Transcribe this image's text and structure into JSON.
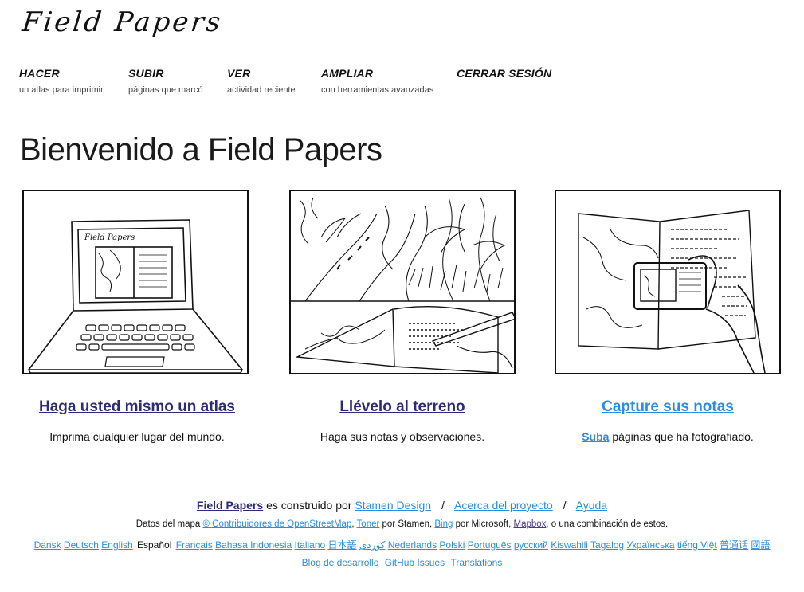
{
  "logo": "Field Papers",
  "nav": [
    {
      "title": "HACER",
      "sub": "un atlas para imprimir"
    },
    {
      "title": "SUBIR",
      "sub": "páginas que marcó"
    },
    {
      "title": "VER",
      "sub": "actividad reciente"
    },
    {
      "title": "AMPLIAR",
      "sub": "con herramientas avanzadas"
    },
    {
      "title": "CERRAR SESIÓN",
      "sub": ""
    }
  ],
  "heading": "Bienvenido a Field Papers",
  "illustration_logo": "Field Papers",
  "columns": [
    {
      "title": "Haga usted mismo un atlas",
      "desc": "Imprima cualquier lugar del mundo.",
      "link_color": "#2b2b7a"
    },
    {
      "title": "Llévelo al terreno",
      "desc": "Haga sus notas y observaciones.",
      "link_color": "#2b2b7a"
    },
    {
      "title": "Capture sus notas",
      "desc_link": "Suba",
      "desc": "páginas que ha fotografiado.",
      "link_color": "#2c8ce0"
    }
  ],
  "footer": {
    "brand": "Field Papers",
    "built_by": "es construido por",
    "stamen": "Stamen Design",
    "about": "Acerca del proyecto",
    "help": "Ayuda",
    "separator": "/",
    "map_data_prefix": "Datos del mapa",
    "osm": "© Contribuidores de OpenStreetMap",
    "comma": ",",
    "toner": "Toner",
    "by_stamen": "por Stamen,",
    "bing": "Bing",
    "by_microsoft": "por Microsoft,",
    "mapbox": "Mapbox",
    "combination": ", o una combinación de estos.",
    "blog": "Blog de desarrollo",
    "github": "GitHub Issues",
    "translations": "Translations"
  },
  "languages": [
    "Dansk",
    "Deutsch",
    "English",
    "Español",
    "Français",
    "Bahasa Indonesia",
    "Italiano",
    "日本語",
    "کوردی",
    "Nederlands",
    "Polski",
    "Português",
    "русский",
    "Kiswahili",
    "Tagalog",
    "Українська",
    "tiếng Việt",
    "普通话",
    "國語"
  ],
  "current_language": "Español",
  "colors": {
    "dark_link": "#2b2b7a",
    "light_link": "#2c8ce0"
  }
}
